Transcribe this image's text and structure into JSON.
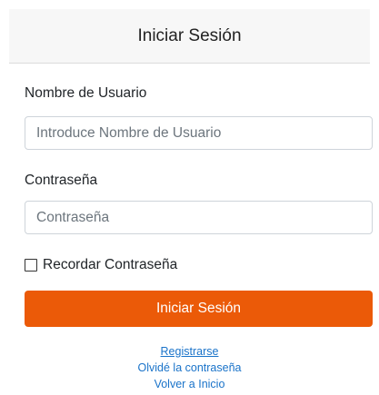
{
  "header": {
    "title": "Iniciar Sesión"
  },
  "form": {
    "username_label": "Nombre de Usuario",
    "username_placeholder": "Introduce Nombre de Usuario",
    "password_label": "Contraseña",
    "password_placeholder": "Contraseña",
    "remember_label": "Recordar Contraseña",
    "remember_checked": false,
    "submit_label": "Iniciar Sesión"
  },
  "links": {
    "register": "Registrarse",
    "forgot_password": "Olvidé la contraseña",
    "back_home": "Volver a Inicio"
  },
  "colors": {
    "primary_button": "#eb5a08",
    "link": "#1a73c9",
    "header_bg": "#f7f7f7"
  }
}
